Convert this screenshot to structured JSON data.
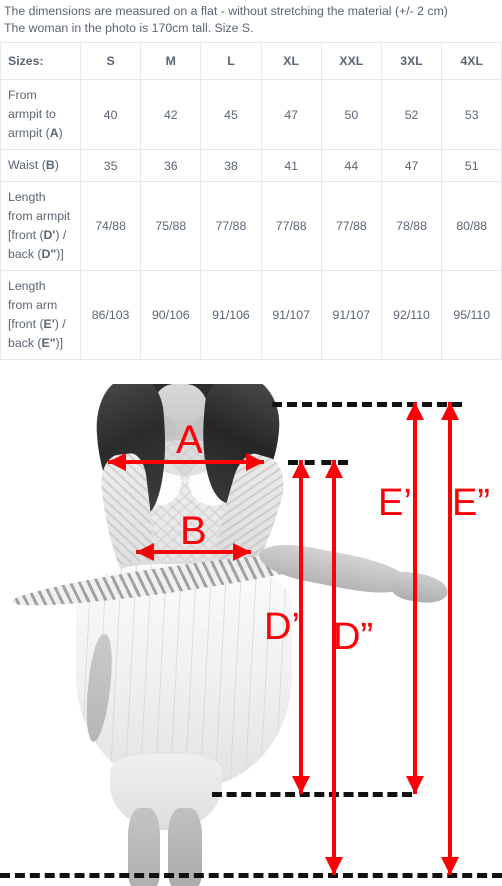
{
  "intro": {
    "line1": "The dimensions are measured on a flat - without stretching the material (+/- 2 cm)",
    "line2": "The woman in the photo is 170cm tall. Size S."
  },
  "table": {
    "headers": [
      "Sizes:",
      "S",
      "M",
      "L",
      "XL",
      "XXL",
      "3XL",
      "4XL"
    ],
    "rows": [
      {
        "label_parts": [
          {
            "text": "From armpit to armpit (",
            "bold": false
          },
          {
            "text": "A",
            "bold": true
          },
          {
            "text": ")",
            "bold": false
          }
        ],
        "label_plain": "From armpit to armpit (A)",
        "values": [
          "40",
          "42",
          "45",
          "47",
          "50",
          "52",
          "53"
        ]
      },
      {
        "label_parts": [
          {
            "text": "Waist (",
            "bold": false
          },
          {
            "text": "B",
            "bold": true
          },
          {
            "text": ")",
            "bold": false
          }
        ],
        "label_plain": "Waist (B)",
        "values": [
          "35",
          "36",
          "38",
          "41",
          "44",
          "47",
          "51"
        ]
      },
      {
        "label_parts": [
          {
            "text": "Length from armpit [front (",
            "bold": false
          },
          {
            "text": "D'",
            "bold": true
          },
          {
            "text": ") / back (",
            "bold": false
          },
          {
            "text": "D\"",
            "bold": true
          },
          {
            "text": ")]",
            "bold": false
          }
        ],
        "label_plain": "Length from armpit [front (D') / back (D\")]",
        "values": [
          "74/88",
          "75/88",
          "77/88",
          "77/88",
          "77/88",
          "78/88",
          "80/88"
        ]
      },
      {
        "label_parts": [
          {
            "text": "Length from arm [front (",
            "bold": false
          },
          {
            "text": "E'",
            "bold": true
          },
          {
            "text": ") / back (",
            "bold": false
          },
          {
            "text": "E\"",
            "bold": true
          },
          {
            "text": ")]",
            "bold": false
          }
        ],
        "label_plain": "Length from arm [front (E') / back (E\")]",
        "values": [
          "86/103",
          "90/106",
          "91/106",
          "91/107",
          "91/107",
          "92/110",
          "95/110"
        ]
      }
    ]
  },
  "diagram": {
    "accent_color": "#fb0007",
    "guide_color": "#111111",
    "labels": {
      "a": "A",
      "b": "B",
      "d_front": "D’",
      "d_back": "D”",
      "e_front": "E’",
      "e_back": "E”"
    },
    "photo_alt": "Woman in white lace skirt dress, grayscale, with red measurement arrows"
  }
}
